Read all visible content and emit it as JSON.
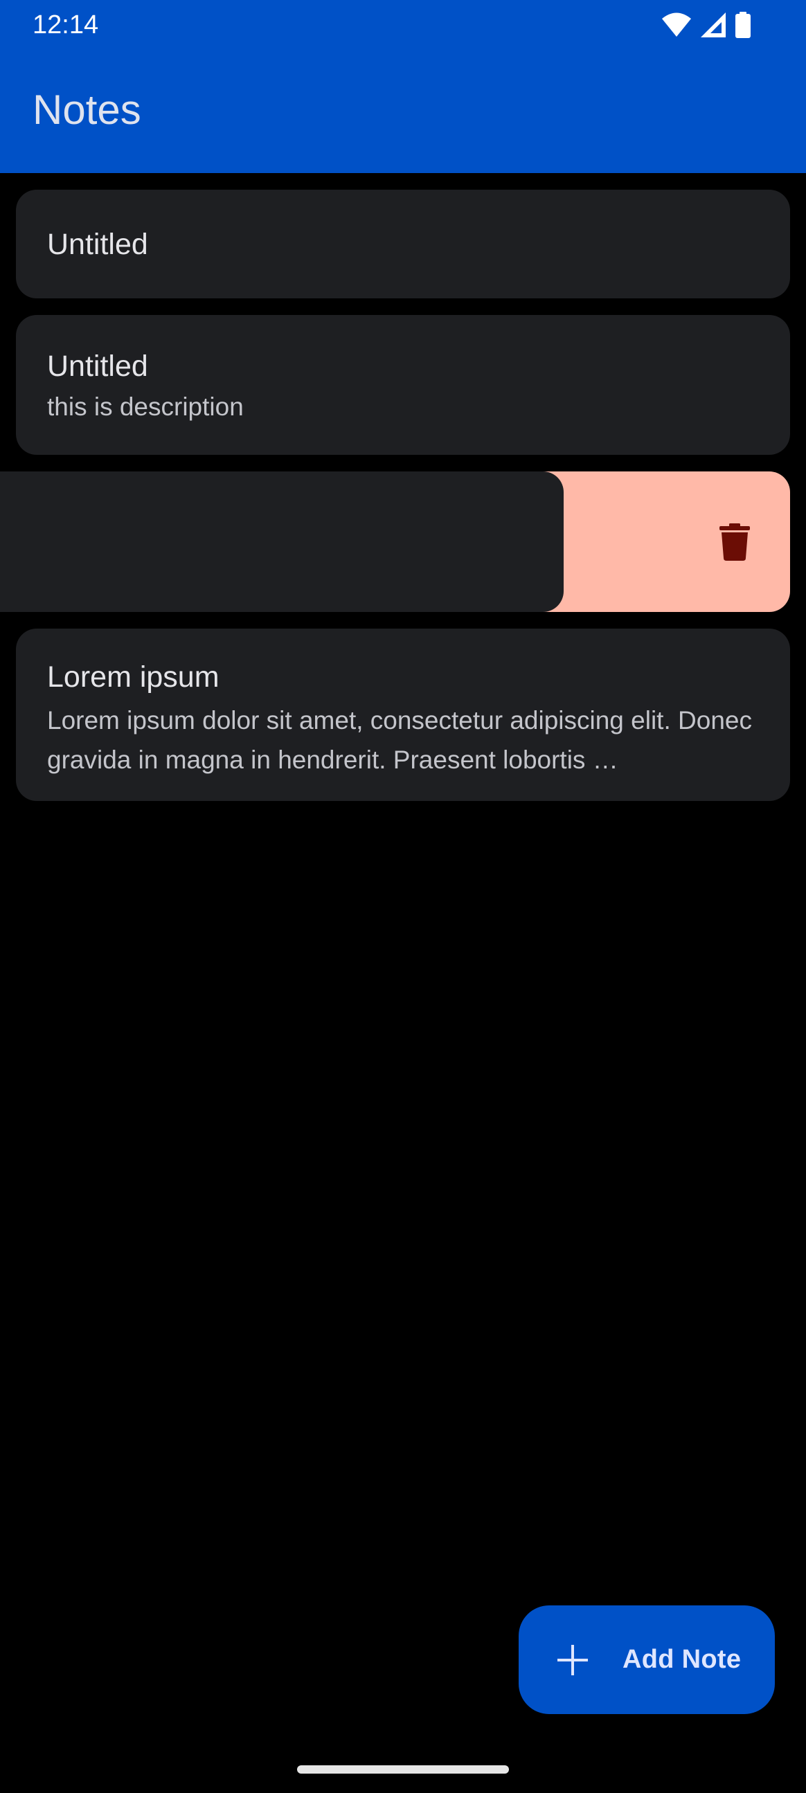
{
  "status_bar": {
    "time": "12:14",
    "icons": [
      "wifi-icon",
      "cell-signal-icon",
      "battery-icon"
    ]
  },
  "app_bar": {
    "title": "Notes"
  },
  "notes": [
    {
      "title": "Untitled",
      "description": ""
    },
    {
      "title": "Untitled",
      "description": "this is description"
    },
    {
      "title": "",
      "description": "",
      "swiped": true,
      "swipe_action_icon": "trash-icon"
    },
    {
      "title": "Lorem ipsum",
      "description": "Lorem ipsum dolor sit amet, consectetur adipiscing elit. Donec gravida in magna in hendrerit. Praesent lobortis …"
    }
  ],
  "fab": {
    "icon": "plus-icon",
    "label": "Add Note"
  },
  "colors": {
    "primary": "#0051c7",
    "background": "#000000",
    "card": "#1e1f22",
    "delete_bg": "#ffb9a8",
    "delete_icon": "#6b0d05"
  }
}
